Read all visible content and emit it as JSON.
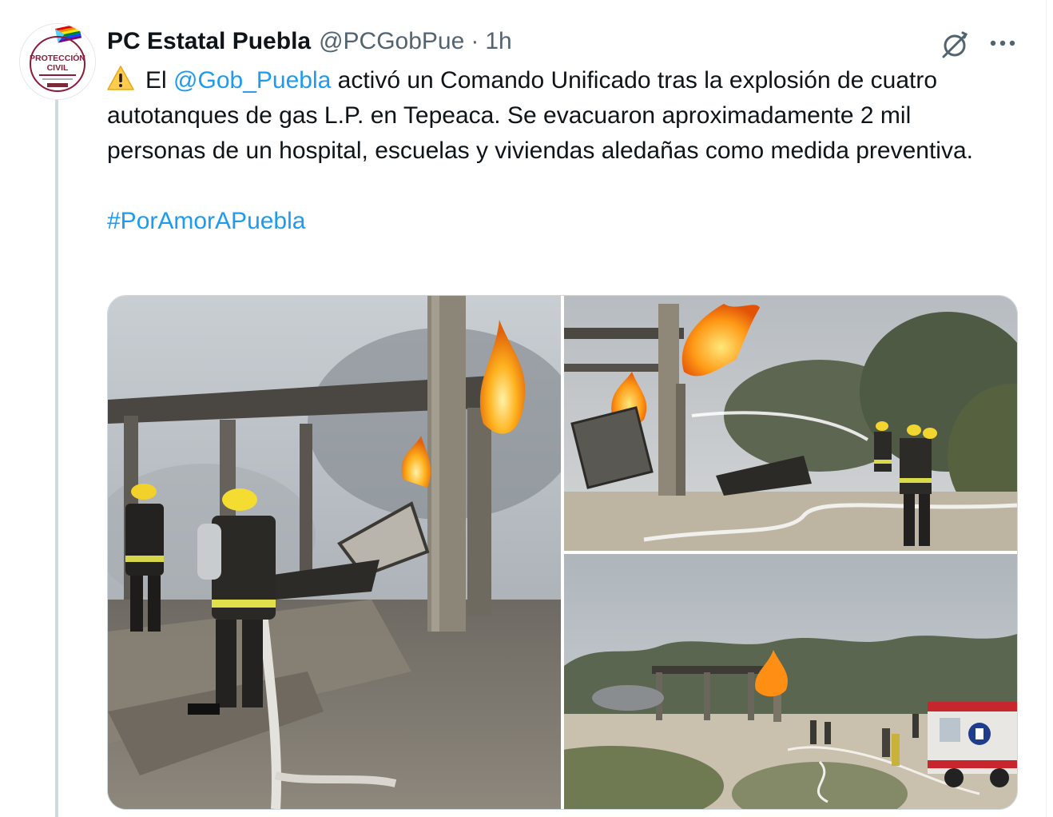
{
  "tweet": {
    "author": {
      "display_name": "PC Estatal Puebla",
      "handle": "@PCGobPue",
      "avatar_text_line1": "PROTECCIÓN",
      "avatar_text_line2": "CIVIL"
    },
    "separator": "·",
    "time": "1h",
    "warning_icon": "warning-icon",
    "text": {
      "mention": "@Gob_Puebla",
      "prefix": "El",
      "body": "activó un Comando Unificado tras la explosión de cuatro autotanques de gas L.P. en Tepeaca. Se evacuaron aproximadamente 2 mil personas de un hospital, escuelas y viviendas aledañas como medida preventiva.",
      "hashtag": "#PorAmorAPuebla"
    },
    "actions": {
      "grok_icon": "grok-icon",
      "more_icon": "more-icon"
    },
    "media": {
      "count": 3,
      "photo_1_subject": "firefighters-at-collapsed-structure-fire",
      "photo_2_subject": "firefighters-spraying-water-on-gas-flames",
      "photo_3_subject": "fire-scene-with-fire-truck"
    }
  },
  "colors": {
    "text": "#0f1419",
    "secondary": "#536471",
    "link": "#1d9bf0",
    "thread_line": "#cfd9de"
  }
}
